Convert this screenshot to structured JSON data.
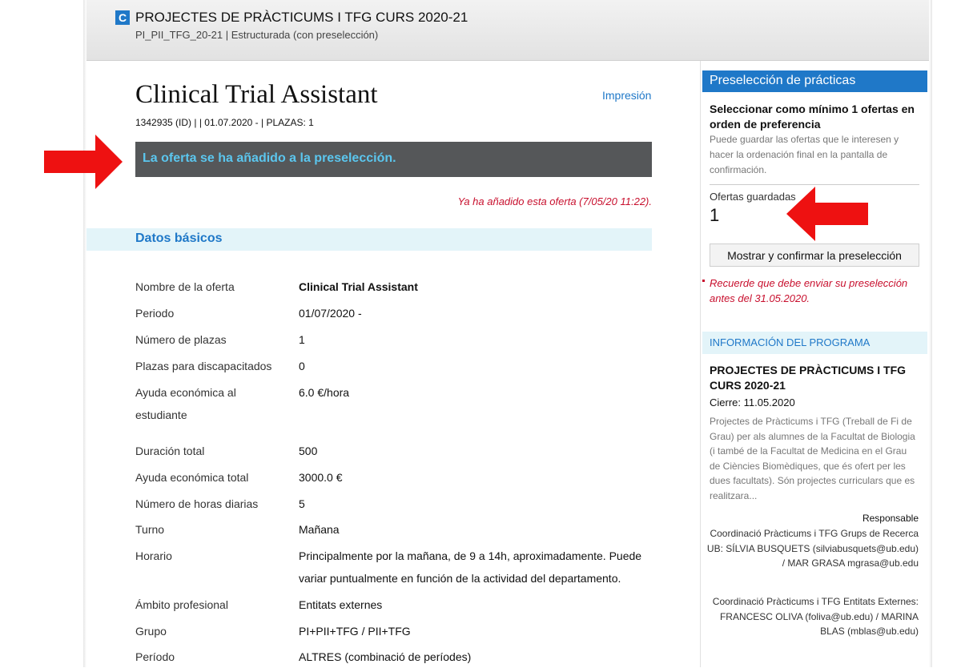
{
  "header": {
    "badge": "C",
    "program_title": "PROJECTES DE PRÀCTICUMS I TFG CURS 2020-21",
    "program_subtitle": "PI_PII_TFG_20-21 | Estructurada (con preselección)"
  },
  "offer": {
    "title": "Clinical Trial Assistant",
    "meta": "1342935 (ID) | | 01.07.2020 -  | PLAZAS: 1",
    "print_link": "Impresión",
    "notice": "La oferta se ha añadido a la preselección.",
    "added_message": "Ya ha añadido esta oferta (7/05/20 11:22)."
  },
  "basic_data": {
    "section_title": "Datos básicos",
    "rows": [
      {
        "label": "Nombre de la oferta",
        "value": "Clinical Trial Assistant"
      },
      {
        "label": "Periodo",
        "value": "01/07/2020  -"
      },
      {
        "label": "Número de plazas",
        "value": "1"
      },
      {
        "label": "Plazas para discapacitados",
        "value": "0"
      },
      {
        "label": "Ayuda económica al estudiante",
        "value": "6.0 €/hora"
      },
      {
        "label": "Duración total",
        "value": "500"
      },
      {
        "label": "Ayuda económica total",
        "value": "3000.0 €"
      },
      {
        "label": "Número de horas diarias",
        "value": "5"
      },
      {
        "label": "Turno",
        "value": "Mañana"
      },
      {
        "label": "Horario",
        "value": "Principalmente por la mañana, de 9 a 14h, aproximadamente. Puede variar puntualmente en función de la actividad del departamento."
      },
      {
        "label": "Ámbito profesional",
        "value": "Entitats externes"
      },
      {
        "label": "Grupo",
        "value": "PI+PII+TFG / PII+TFG"
      },
      {
        "label": "Período",
        "value": "ALTRES (combinació de períodes)"
      }
    ]
  },
  "sidebar": {
    "heading": "Preselección de prácticas",
    "instruction_bold": "Seleccionar como mínimo 1 ofertas en orden de preferencia",
    "instruction_small": "Puede guardar las ofertas que le interesen y hacer la ordenación final en la pantalla de confirmación.",
    "saved_label": "Ofertas guardadas",
    "saved_count": "1",
    "confirm_button": "Mostrar y confirmar la preselección",
    "reminder": "Recuerde que debe enviar su preselección antes del 31.05.2020.",
    "program_info": {
      "heading": "INFORMACIÓN DEL PROGRAMA",
      "name": "PROJECTES DE PRÀCTICUMS I TFG CURS 2020-21",
      "closing": "Cierre: 11.05.2020",
      "description": "Projectes de Pràcticums i TFG (Treball de Fi de Grau) per als alumnes de la Facultat de Biologia (i també de la Facultat de Medicina en el Grau de Ciències Biomèdiques, que és ofert per les dues facultats). Són projectes curriculars que es realitzara...",
      "responsible_title": "Responsable",
      "responsible_1": "Coordinació Pràcticums i TFG Grups de Recerca UB: SÍLVIA BUSQUETS (silviabusquets@ub.edu) / MAR GRASA mgrasa@ub.edu",
      "responsible_2": "Coordinació Pràcticums i TFG Entitats Externes: FRANCESC OLIVA (foliva@ub.edu) / MARINA BLAS (mblas@ub.edu)"
    }
  },
  "colors": {
    "link_blue": "#1f78c8",
    "notice_bg": "#555759",
    "notice_text": "#5bc6ee",
    "alert_red": "#c8102e",
    "annotation_red": "#ee1111",
    "section_bg": "#e3f4f9"
  },
  "annotations": {
    "arrow_icon": "red-arrow-icon"
  }
}
